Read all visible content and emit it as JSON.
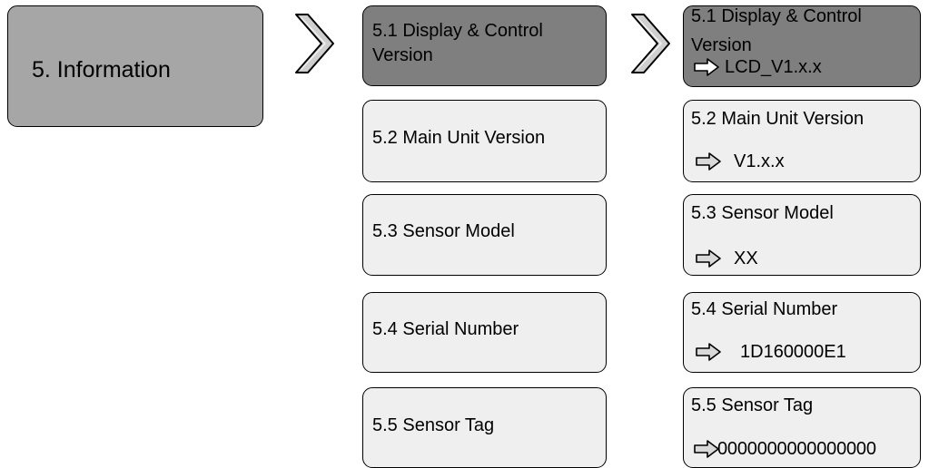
{
  "main_item": {
    "label": "5. Information"
  },
  "submenu": [
    {
      "label_lines": [
        "5.1 Display & Control",
        "Version"
      ]
    },
    {
      "label_lines": [
        "5.2 Main Unit Version"
      ]
    },
    {
      "label_lines": [
        "5.3 Sensor Model"
      ]
    },
    {
      "label_lines": [
        "5.4 Serial Number"
      ]
    },
    {
      "label_lines": [
        "5.5 Sensor Tag"
      ]
    }
  ],
  "details": [
    {
      "label_lines": [
        "5.1 Display & Control",
        "Version"
      ],
      "value": "LCD_V1.x.x"
    },
    {
      "label_lines": [
        "5.2 Main Unit Version"
      ],
      "value": "V1.x.x"
    },
    {
      "label_lines": [
        "5.3 Sensor Model"
      ],
      "value": "XX"
    },
    {
      "label_lines": [
        "5.4 Serial Number"
      ],
      "value": "1D160000E1"
    },
    {
      "label_lines": [
        "5.5 Sensor Tag"
      ],
      "value": "0000000000000000"
    }
  ],
  "colors": {
    "selected_fill": "#7f7f7f",
    "normal_fill": "#efefef",
    "main_fill": "#a6a6a6"
  },
  "icons": {
    "chevron": "chevron-right-icon",
    "value_arrow": "arrow-right-outline-icon"
  }
}
